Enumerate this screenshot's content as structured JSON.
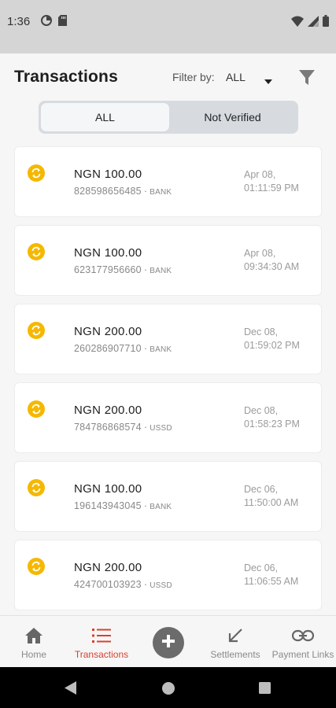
{
  "status_bar": {
    "time": "1:36"
  },
  "header": {
    "title": "Transactions",
    "filter_label": "Filter by:",
    "filter_value": "ALL"
  },
  "segments": {
    "all": "ALL",
    "not_verified": "Not Verified",
    "selected": "ALL"
  },
  "transactions": [
    {
      "amount": "NGN 100.00",
      "reference": "828598656485",
      "channel": "BANK",
      "date_line1": "Apr 08,",
      "date_line2": "01:11:59 PM"
    },
    {
      "amount": "NGN 100.00",
      "reference": "623177956660",
      "channel": "BANK",
      "date_line1": "Apr 08,",
      "date_line2": "09:34:30 AM"
    },
    {
      "amount": "NGN 200.00",
      "reference": "260286907710",
      "channel": "BANK",
      "date_line1": "Dec 08,",
      "date_line2": "01:59:02 PM"
    },
    {
      "amount": "NGN 200.00",
      "reference": "784786868574",
      "channel": "USSD",
      "date_line1": "Dec 08,",
      "date_line2": "01:58:23 PM"
    },
    {
      "amount": "NGN 100.00",
      "reference": "196143943045",
      "channel": "BANK",
      "date_line1": "Dec 06,",
      "date_line2": "11:50:00 AM"
    },
    {
      "amount": "NGN 200.00",
      "reference": "424700103923",
      "channel": "USSD",
      "date_line1": "Dec 06,",
      "date_line2": "11:06:55 AM"
    }
  ],
  "bottom_nav": {
    "home": "Home",
    "transactions": "Transactions",
    "settlements": "Settlements",
    "payment_links": "Payment Links",
    "active": "transactions"
  },
  "colors": {
    "accent": "#d9412f",
    "pending_icon": "#f5b800",
    "fab": "#6b6b6b"
  },
  "icons": {
    "status_left": [
      "data-saver-icon",
      "sd-card-icon"
    ],
    "status_right": [
      "wifi-icon",
      "cell-signal-icon",
      "battery-icon"
    ],
    "filter": "funnel-icon",
    "transaction_status": "sync-pending-icon",
    "nav": [
      "home-icon",
      "list-icon",
      "add-icon",
      "arrow-down-left-icon",
      "link-icon"
    ]
  }
}
